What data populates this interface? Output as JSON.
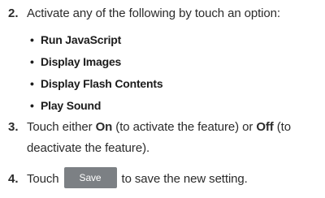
{
  "steps": [
    {
      "number": "2.",
      "text": "Activate any of the following by touch an option:"
    },
    {
      "number": "3.",
      "line1_pre": "Touch either ",
      "on_label": "On",
      "line1_mid": " (to activate the feature) or ",
      "off_label": "Off",
      "line1_post": " (to",
      "line2": "deactivate the feature)."
    },
    {
      "number": "4.",
      "pre": "Touch",
      "button_label": "Save",
      "post": "to save the new setting."
    }
  ],
  "bullets": [
    {
      "bullet": "•",
      "label": "Run JavaScript"
    },
    {
      "bullet": "•",
      "label": "Display Images"
    },
    {
      "bullet": "•",
      "label": "Display Flash Contents"
    },
    {
      "bullet": "•",
      "label": "Play Sound"
    }
  ],
  "colors": {
    "text": "#2b2b2b",
    "save_button_bg": "#7c8084",
    "save_button_text": "#ffffff"
  }
}
